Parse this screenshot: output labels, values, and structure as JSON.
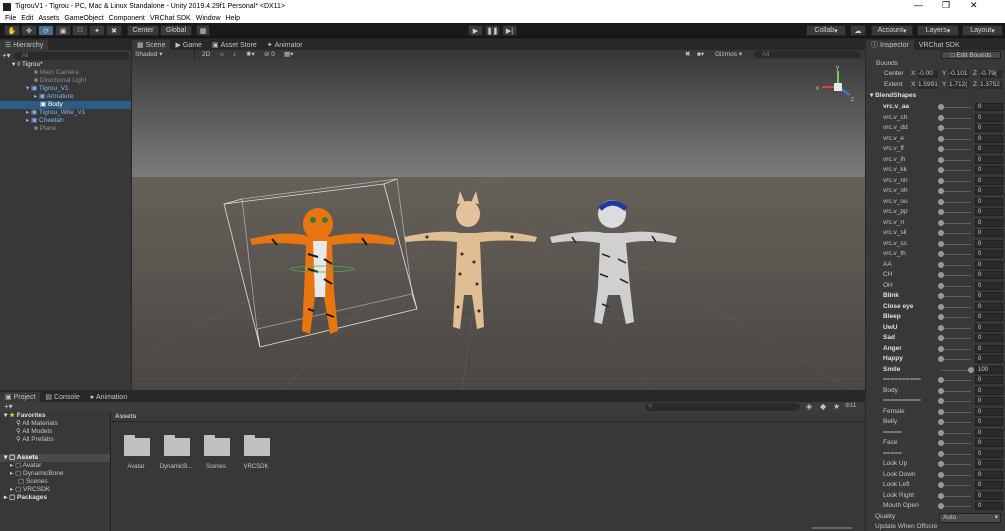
{
  "window": {
    "title": "TigrouV1 - Tigrou - PC, Mac & Linux Standalone - Unity 2019.4.29f1 Personal* <DX11>"
  },
  "menu": [
    "File",
    "Edit",
    "Assets",
    "GameObject",
    "Component",
    "VRChat SDK",
    "Window",
    "Help"
  ],
  "toolbar": {
    "center": "Center",
    "global": "Global",
    "collab": "Collab",
    "account": "Account",
    "layers": "Layers",
    "layout": "Layout"
  },
  "hierarchy": {
    "tab": "Hierarchy",
    "search_placeholder": "All",
    "scene": "Tigrou*",
    "items": [
      {
        "label": "Main Camera",
        "depth": 1,
        "state": "disabled"
      },
      {
        "label": "Directional Light",
        "depth": 1,
        "state": "disabled"
      },
      {
        "label": "Tigrou_V1",
        "depth": 1,
        "state": "prefab"
      },
      {
        "label": "Armature",
        "depth": 2,
        "state": "prefab"
      },
      {
        "label": "Body",
        "depth": 2,
        "state": "selected"
      },
      {
        "label": "Tigrou_Wite_V1",
        "depth": 1,
        "state": "prefab"
      },
      {
        "label": "Cheetah",
        "depth": 1,
        "state": "prefab"
      },
      {
        "label": "Plane",
        "depth": 1,
        "state": "disabled"
      }
    ]
  },
  "scene_view": {
    "tabs": [
      "Scene",
      "Game",
      "Asset Store",
      "Animator"
    ],
    "shading": "Shaded",
    "mode_2d": "2D",
    "hidden_count": "0",
    "gizmos": "Gizmos",
    "search_placeholder": "All",
    "axes": {
      "x": "x",
      "y": "y",
      "z": "z"
    }
  },
  "inspector": {
    "tabs": [
      "Inspector",
      "VRChat SDK"
    ],
    "edit_bounds": "Edit Bounds",
    "bounds_label": "Bounds",
    "center_label": "Center",
    "extent_label": "Extent",
    "center": {
      "x": "-0.00",
      "y": "-0.101",
      "z": "-0.79("
    },
    "extent": {
      "x": "1.5991",
      "y": "1.712(",
      "z": "1.3752"
    },
    "blendshapes_title": "BlendShapes",
    "blendshapes": [
      {
        "name": "vrc.v_aa",
        "value": "0",
        "bold": true
      },
      {
        "name": "vrc.v_ch",
        "value": "0",
        "bold": false
      },
      {
        "name": "vrc.v_dd",
        "value": "0",
        "bold": false
      },
      {
        "name": "vrc.v_e",
        "value": "0",
        "bold": false
      },
      {
        "name": "vrc.v_ff",
        "value": "0",
        "bold": false
      },
      {
        "name": "vrc.v_ih",
        "value": "0",
        "bold": false
      },
      {
        "name": "vrc.v_kk",
        "value": "0",
        "bold": false
      },
      {
        "name": "vrc.v_nn",
        "value": "0",
        "bold": false
      },
      {
        "name": "vrc.v_oh",
        "value": "0",
        "bold": false
      },
      {
        "name": "vrc.v_ou",
        "value": "0",
        "bold": false
      },
      {
        "name": "vrc.v_pp",
        "value": "0",
        "bold": false
      },
      {
        "name": "vrc.v_rr",
        "value": "0",
        "bold": false
      },
      {
        "name": "vrc.v_sil",
        "value": "0",
        "bold": false
      },
      {
        "name": "vrc.v_ss",
        "value": "0",
        "bold": false
      },
      {
        "name": "vrc.v_th",
        "value": "0",
        "bold": false
      },
      {
        "name": "AA",
        "value": "0",
        "bold": false
      },
      {
        "name": "CH",
        "value": "0",
        "bold": false
      },
      {
        "name": "OH",
        "value": "0",
        "bold": false
      },
      {
        "name": "Blink",
        "value": "0",
        "bold": true
      },
      {
        "name": "Close eye",
        "value": "0",
        "bold": true
      },
      {
        "name": "Bleep",
        "value": "0",
        "bold": true
      },
      {
        "name": "UwU",
        "value": "0",
        "bold": true
      },
      {
        "name": "Sad",
        "value": "0",
        "bold": true
      },
      {
        "name": "Anger",
        "value": "0",
        "bold": true
      },
      {
        "name": "Happy",
        "value": "0",
        "bold": true
      },
      {
        "name": "Smile",
        "value": "100",
        "bold": true
      },
      {
        "name": "==========",
        "value": "0",
        "bold": false
      },
      {
        "name": "Body",
        "value": "0",
        "bold": false
      },
      {
        "name": "==========",
        "value": "0",
        "bold": false
      },
      {
        "name": "Female",
        "value": "0",
        "bold": false
      },
      {
        "name": "Belly",
        "value": "0",
        "bold": false
      },
      {
        "name": "=====",
        "value": "0",
        "bold": false
      },
      {
        "name": "Face",
        "value": "0",
        "bold": false
      },
      {
        "name": "=====",
        "value": "0",
        "bold": false
      },
      {
        "name": "Look Up",
        "value": "0",
        "bold": false
      },
      {
        "name": "Look Down",
        "value": "0",
        "bold": false
      },
      {
        "name": "Look Left",
        "value": "0",
        "bold": false
      },
      {
        "name": "Look Right",
        "value": "0",
        "bold": false
      },
      {
        "name": "Mouth Open",
        "value": "0",
        "bold": false
      }
    ],
    "quality_label": "Quality",
    "quality_value": "Auto",
    "update_label": "Update When Offscre"
  },
  "project": {
    "tabs": [
      "Project",
      "Console",
      "Animation"
    ],
    "favorites": "Favorites",
    "favorite_items": [
      "All Materials",
      "All Models",
      "All Prefabs"
    ],
    "assets": "Assets",
    "asset_items": [
      "Avatar",
      "DynamicBone",
      "Scenes",
      "VRCSDK"
    ],
    "packages": "Packages",
    "breadcrumb": "Assets",
    "badge_count": "11",
    "grid": [
      "Avatar",
      "DynamicB...",
      "Scenes",
      "VRCSDK"
    ]
  },
  "colors": {
    "selection": "#2c5d87",
    "prefab_text": "#7fb4ff",
    "panel": "#383838",
    "sky_top": "#606060",
    "ground": "#55504c"
  }
}
